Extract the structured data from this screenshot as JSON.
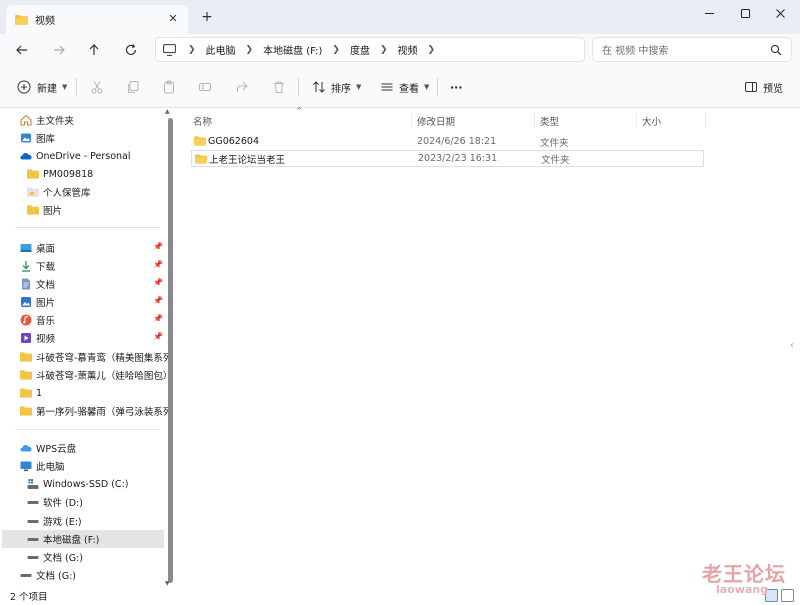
{
  "window": {
    "tab_title": "视频",
    "colors": {
      "folder": "#f2c443",
      "accent": "#0067c0",
      "chrome": "#e9eef5"
    }
  },
  "address": {
    "breadcrumbs": [
      "此电脑",
      "本地磁盘 (F:)",
      "度盘",
      "视频"
    ],
    "search_placeholder": "在 视频 中搜索"
  },
  "toolbar": {
    "new_label": "新建",
    "sort_label": "排序",
    "view_label": "查看",
    "more_label": "···",
    "preview_label": "预览"
  },
  "sidebar": {
    "items": [
      {
        "label": "主文件夹",
        "icon": "home-icon",
        "pinned": false
      },
      {
        "label": "图库",
        "icon": "gallery-icon",
        "pinned": false
      },
      {
        "label": "OneDrive - Personal",
        "icon": "onedrive-icon",
        "pinned": false
      },
      {
        "label": "PM009818",
        "icon": "folder-icon",
        "pinned": false
      },
      {
        "label": "个人保管库",
        "icon": "vault-icon",
        "pinned": false
      },
      {
        "label": "图片",
        "icon": "folder-icon",
        "pinned": false
      },
      {
        "label": "桌面",
        "icon": "desktop-icon",
        "pinned": true
      },
      {
        "label": "下载",
        "icon": "download-icon",
        "pinned": true
      },
      {
        "label": "文档",
        "icon": "document-icon",
        "pinned": true
      },
      {
        "label": "图片",
        "icon": "pictures-icon",
        "pinned": true
      },
      {
        "label": "音乐",
        "icon": "music-icon",
        "pinned": true
      },
      {
        "label": "视频",
        "icon": "video-icon",
        "pinned": true
      },
      {
        "label": "斗破苍穹-慕青鸾（精美图集系列",
        "icon": "folder-icon",
        "pinned": false
      },
      {
        "label": "斗破苍穹-萧薰儿（娃哈哈图包）",
        "icon": "folder-icon",
        "pinned": false
      },
      {
        "label": "1",
        "icon": "folder-icon",
        "pinned": false
      },
      {
        "label": "第一序列-骆馨雨（弹弓泳装系列",
        "icon": "folder-icon",
        "pinned": false
      },
      {
        "label": "WPS云盘",
        "icon": "cloud-icon",
        "pinned": false
      },
      {
        "label": "此电脑",
        "icon": "computer-icon",
        "pinned": false
      },
      {
        "label": "Windows-SSD (C:)",
        "icon": "system-drive-icon",
        "pinned": false
      },
      {
        "label": "软件 (D:)",
        "icon": "drive-icon",
        "pinned": false
      },
      {
        "label": "游戏 (E:)",
        "icon": "drive-icon",
        "pinned": false
      },
      {
        "label": "本地磁盘 (F:)",
        "icon": "drive-icon",
        "pinned": false
      },
      {
        "label": "文档 (G:)",
        "icon": "drive-icon",
        "pinned": false
      },
      {
        "label": "文档 (G:)",
        "icon": "drive-icon",
        "pinned": false
      }
    ]
  },
  "columns": {
    "name": "名称",
    "modified": "修改日期",
    "type": "类型",
    "size": "大小"
  },
  "files": [
    {
      "name": "GG062604",
      "modified": "2024/6/26 18:21",
      "type": "文件夹"
    },
    {
      "name": "上老王论坛当老王",
      "modified": "2023/2/23 16:31",
      "type": "文件夹"
    }
  ],
  "status": {
    "item_count": "2 个项目"
  },
  "watermark": {
    "text": "老王论坛",
    "sub": "laowang"
  }
}
